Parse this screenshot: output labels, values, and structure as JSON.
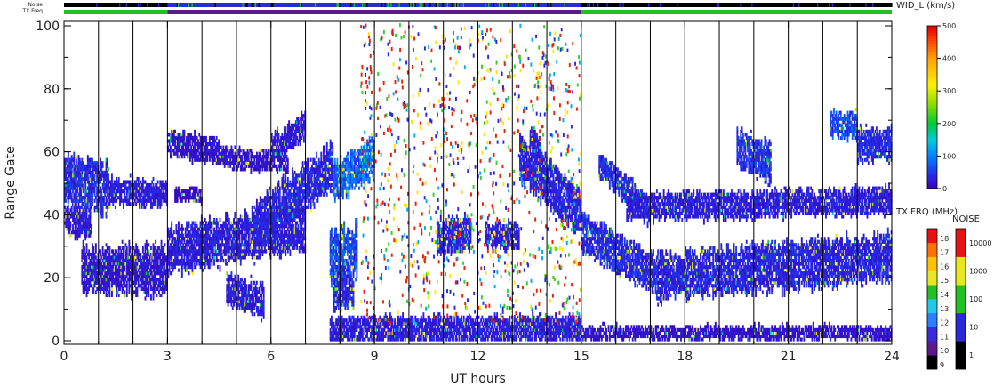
{
  "chart_data": {
    "type": "heatmap",
    "xlabel": "UT hours",
    "ylabel": "Range Gate",
    "xlim": [
      0,
      24
    ],
    "ylim": [
      0,
      100
    ],
    "xticks": [
      0,
      3,
      6,
      9,
      12,
      15,
      18,
      21,
      24
    ],
    "xtick_labels": [
      "0",
      "3",
      "6",
      "9",
      "12",
      "15",
      "18",
      "21",
      "24"
    ],
    "yticks": [
      0,
      20,
      40,
      60,
      80,
      100
    ],
    "ytick_labels": [
      "0",
      "20",
      "40",
      "60",
      "80",
      "100"
    ],
    "hour_gridlines": [
      1,
      2,
      3,
      4,
      5,
      6,
      7,
      8,
      9,
      10,
      11,
      12,
      13,
      14,
      15,
      16,
      17,
      18,
      19,
      20,
      21,
      22,
      23
    ],
    "top_strips": {
      "noise_label": "Noise",
      "txfreq_label": "TX Freq",
      "txfreq_segments": [
        {
          "from": 0,
          "to": 3,
          "mhz": 14
        },
        {
          "from": 3,
          "to": 15,
          "mhz": 10
        },
        {
          "from": 15,
          "to": 24,
          "mhz": 14
        }
      ],
      "noise_segments": [
        {
          "from": 0,
          "to": 3,
          "level": "low"
        },
        {
          "from": 3,
          "to": 9,
          "level": "mid"
        },
        {
          "from": 9,
          "to": 15,
          "level": "mid-high"
        },
        {
          "from": 15,
          "to": 24,
          "level": "low"
        }
      ]
    },
    "echo_regions": [
      {
        "t0": 0.0,
        "t1": 1.3,
        "g_center_start": 50,
        "g_center_end": 48,
        "half_width": 7,
        "width_value": 40
      },
      {
        "t0": 1.3,
        "t1": 3.0,
        "g_center_start": 47,
        "g_center_end": 46,
        "half_width": 3,
        "width_value": 30
      },
      {
        "t0": 0.0,
        "t1": 0.8,
        "g_center_start": 38,
        "g_center_end": 36,
        "half_width": 3,
        "width_value": 25
      },
      {
        "t0": 0.5,
        "t1": 3.0,
        "g_center_start": 22,
        "g_center_end": 22,
        "half_width": 6,
        "width_value": 25
      },
      {
        "t0": 3.0,
        "t1": 7.0,
        "g_center_start": 28,
        "g_center_end": 36,
        "half_width": 6,
        "width_value": 30
      },
      {
        "t0": 5.5,
        "t1": 7.8,
        "g_center_start": 36,
        "g_center_end": 55,
        "half_width": 6,
        "width_value": 35
      },
      {
        "t0": 3.0,
        "t1": 4.5,
        "g_center_start": 62,
        "g_center_end": 60,
        "half_width": 3,
        "width_value": 20
      },
      {
        "t0": 4.5,
        "t1": 6.5,
        "g_center_start": 58,
        "g_center_end": 56,
        "half_width": 2,
        "width_value": 20
      },
      {
        "t0": 3.2,
        "t1": 4.0,
        "g_center_start": 46,
        "g_center_end": 46,
        "half_width": 1,
        "width_value": 15
      },
      {
        "t0": 4.7,
        "t1": 5.8,
        "g_center_start": 16,
        "g_center_end": 12,
        "half_width": 4,
        "width_value": 30
      },
      {
        "t0": 6.0,
        "t1": 7.0,
        "g_center_start": 60,
        "g_center_end": 68,
        "half_width": 3,
        "width_value": 25
      },
      {
        "t0": 7.7,
        "t1": 8.5,
        "g_center_start": 26,
        "g_center_end": 28,
        "half_width": 7,
        "width_value": 60
      },
      {
        "t0": 7.8,
        "t1": 8.4,
        "g_center_start": 14,
        "g_center_end": 16,
        "half_width": 4,
        "width_value": 40
      },
      {
        "t0": 7.8,
        "t1": 9.0,
        "g_center_start": 50,
        "g_center_end": 58,
        "half_width": 5,
        "width_value": 80
      },
      {
        "t0": 7.7,
        "t1": 15.0,
        "g_center_start": 3,
        "g_center_end": 3,
        "half_width": 3,
        "width_value": 30
      },
      {
        "t0": 15.0,
        "t1": 24.0,
        "g_center_start": 2,
        "g_center_end": 2,
        "half_width": 1,
        "width_value": 20
      },
      {
        "t0": 10.8,
        "t1": 11.8,
        "g_center_start": 32,
        "g_center_end": 34,
        "half_width": 4,
        "width_value": 35
      },
      {
        "t0": 12.2,
        "t1": 13.2,
        "g_center_start": 33,
        "g_center_end": 33,
        "half_width": 3,
        "width_value": 30
      },
      {
        "t0": 13.2,
        "t1": 15.0,
        "g_center_start": 58,
        "g_center_end": 40,
        "half_width": 6,
        "width_value": 35
      },
      {
        "t0": 13.5,
        "t1": 13.8,
        "g_center_start": 64,
        "g_center_end": 60,
        "half_width": 3,
        "width_value": 30
      },
      {
        "t0": 15.5,
        "t1": 17.0,
        "g_center_start": 56,
        "g_center_end": 40,
        "half_width": 3,
        "width_value": 40
      },
      {
        "t0": 16.3,
        "t1": 24.0,
        "g_center_start": 42,
        "g_center_end": 44,
        "half_width": 3,
        "width_value": 30
      },
      {
        "t0": 15.0,
        "t1": 17.2,
        "g_center_start": 34,
        "g_center_end": 20,
        "half_width": 5,
        "width_value": 40
      },
      {
        "t0": 17.2,
        "t1": 24.0,
        "g_center_start": 20,
        "g_center_end": 26,
        "half_width": 6,
        "width_value": 35
      },
      {
        "t0": 19.5,
        "t1": 20.5,
        "g_center_start": 60,
        "g_center_end": 56,
        "half_width": 5,
        "width_value": 45
      },
      {
        "t0": 22.2,
        "t1": 23.0,
        "g_center_start": 68,
        "g_center_end": 68,
        "half_width": 3,
        "width_value": 60
      },
      {
        "t0": 23.0,
        "t1": 24.0,
        "g_center_start": 62,
        "g_center_end": 62,
        "half_width": 4,
        "width_value": 40
      }
    ],
    "scatter_region": {
      "t0": 8.6,
      "t1": 15.0,
      "g0": 5,
      "g1": 100,
      "density": 0.06
    }
  },
  "colorbars": {
    "width": {
      "label": "WID_L (km/s)",
      "min": 0,
      "max": 500,
      "ticks": [
        "0",
        "100",
        "200",
        "300",
        "400",
        "500"
      ]
    },
    "txfreq": {
      "label": "TX FRQ (MHz)",
      "ticks": [
        "9",
        "10",
        "11",
        "12",
        "13",
        "14",
        "15",
        "16",
        "17",
        "18"
      ],
      "colors": [
        "#000000",
        "#5a1a8c",
        "#3a2ad8",
        "#2f7dff",
        "#22c8e8",
        "#22c022",
        "#e8e820",
        "#ffc000",
        "#ff7000",
        "#e81010"
      ]
    },
    "noise": {
      "label": "NOISE",
      "ticks": [
        "1",
        "10",
        "100",
        "1000",
        "10000"
      ],
      "colors": [
        "#000000",
        "#2a2ad8",
        "#22c022",
        "#e8e820",
        "#e81010"
      ]
    }
  }
}
